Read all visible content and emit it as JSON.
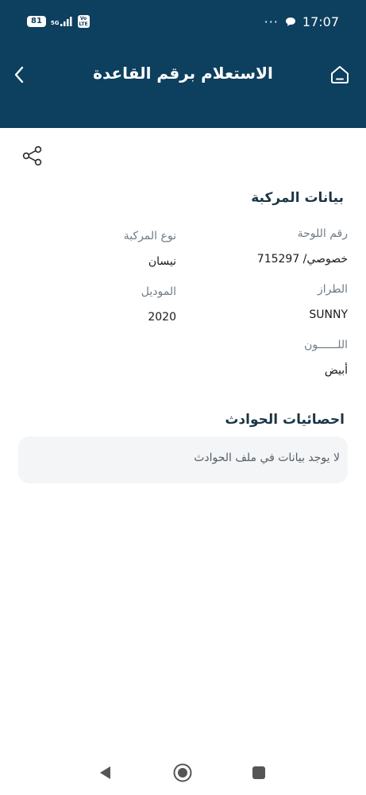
{
  "status_bar": {
    "battery": "81",
    "network": "5G",
    "volte_top": "Vo",
    "volte_bottom": "LTE",
    "dots": "···",
    "time": "17:07"
  },
  "header": {
    "title": "الاستعلام برقم القاعدة",
    "back_icon": "chevron-left-icon",
    "home_icon": "home-icon"
  },
  "share_icon": "share-icon",
  "vehicle_section": {
    "title": "بيانات المركبة",
    "plate_label": "رقم اللوحة",
    "plate_value": "خصوصي/ 715297",
    "vehicle_type_label": "نوع المركبة",
    "vehicle_type_value": "نيسان",
    "model_label": "الطراز",
    "model_value": "SUNNY",
    "year_label": "الموديل",
    "year_value": "2020",
    "color_label": "اللــــــون",
    "color_value": "أبيض"
  },
  "accidents_section": {
    "title": "احصائيات الحوادث",
    "empty_message": "لا يوجد بيانات  في ملف الحوادث"
  },
  "nav_bar": {
    "back_icon": "triangle-back-icon",
    "home_icon": "circle-home-icon",
    "recents_icon": "square-recents-icon"
  },
  "colors": {
    "header_bg": "#0d3f5f",
    "section_title": "#1c3545",
    "label": "#6f7c86",
    "empty_box_bg": "#f3f5f7"
  }
}
